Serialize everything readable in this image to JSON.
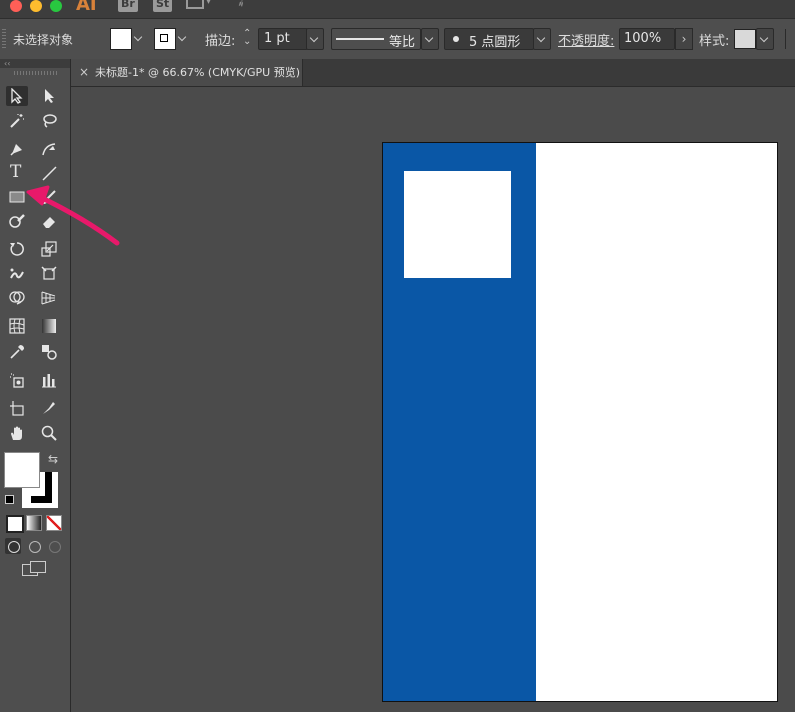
{
  "app": {
    "logo": "AI",
    "bridge_label": "Br",
    "stock_label": "St",
    "traffic_lights": [
      "#ff5f57",
      "#febc2e",
      "#28c840"
    ]
  },
  "control_bar": {
    "selection_status": "未选择对象",
    "stroke_label": "描边:",
    "stroke_value": "1 pt",
    "stroke_profile_label": "等比",
    "brush_label": "5 点圆形",
    "opacity_label": "不透明度:",
    "opacity_value": "100%",
    "style_label": "样式:"
  },
  "document_tab": {
    "close_label": "×",
    "title": "未标题-1* @ 66.67% (CMYK/GPU 预览)"
  },
  "tools": [
    "selection-tool",
    "direct-selection-tool",
    "magic-wand-tool",
    "lasso-tool",
    "pen-tool",
    "curvature-tool",
    "type-tool",
    "line-segment-tool",
    "rectangle-tool",
    "paintbrush-tool",
    "shaper-tool",
    "eraser-tool",
    "rotate-tool",
    "scale-tool",
    "puppet-warp-tool",
    "free-transform-tool",
    "shape-builder-tool",
    "perspective-grid-tool",
    "mesh-tool",
    "gradient-tool",
    "eyedropper-tool",
    "blend-tool",
    "symbol-sprayer-tool",
    "column-graph-tool",
    "artboard-tool",
    "slice-tool",
    "hand-tool",
    "zoom-tool"
  ],
  "type_tool_glyph": "T",
  "colors": {
    "fill": "#ffffff",
    "stroke": "#000000",
    "artboard_blue": "#0a57a6",
    "arrow": "#e8196a"
  }
}
